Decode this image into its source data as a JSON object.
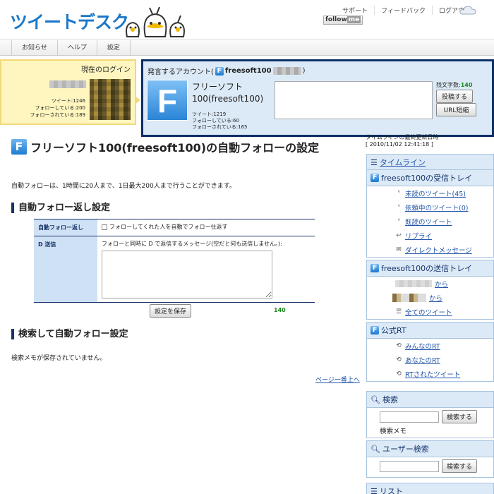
{
  "header": {
    "logo_text": "ツイートデスク",
    "nav": [
      "サポート",
      "フィードバック",
      "ログアウト"
    ],
    "followme_a": "follow",
    "followme_b": "me"
  },
  "menu": [
    "お知らせ",
    "ヘルプ",
    "設定"
  ],
  "login": {
    "title": "現在のログイン",
    "stats": [
      "ツイート:1246",
      "フォローしている:200",
      "フォローされている:189"
    ]
  },
  "post": {
    "title_prefix": "発言するアカウント(",
    "title_account": "freesoft100",
    "title_suffix": ")",
    "name": "フリーソフト100(freesoft100)",
    "stats": [
      "ツイート:1219",
      "フォローしている:60",
      "フォローされている:165"
    ],
    "remaining_label": "残文字数:",
    "remaining_value": "140",
    "submit_label": "投稿する",
    "shorten_label": "URL短縮"
  },
  "main": {
    "title": "フリーソフト100(freesoft100)の自動フォローの設定",
    "intro": "自動フォローは、1時間に20人まで、1日最大200人まで行うことができます。",
    "section1_title": "自動フォロー返し設定",
    "row1_label": "自動フォロー返し",
    "row1_text": "フォローしてくれた人を自動でフォロー仕返す",
    "row2_label": "D 送信",
    "row2_text": "フォローと同時に D で返信するメッセージ(空だと何も送信しません。):",
    "dm_count": "140",
    "save_label": "設定を保存",
    "section2_title": "検索して自動フォロー設定",
    "no_memo": "検索メモが保存されていません。",
    "to_top": "ページ一番上へ"
  },
  "sidebar": {
    "last_update_label": "タイムラインの最終更新日時",
    "last_update_value": "[ 2010/11/02 12:41:18 ]",
    "timeline": "タイムライン",
    "inbox_title": "freesoft100の受信トレイ",
    "inbox_items": [
      "未読のツイート(45)",
      "依頼中のツイート(0)",
      "既読のツイート",
      "リプライ",
      "ダイレクトメッセージ"
    ],
    "outbox_title": "freesoft100の送信トレイ",
    "outbox_from": "から",
    "outbox_all": "全てのツイート",
    "rt_title": "公式RT",
    "rt_items": [
      "みんなのRT",
      "あなたのRT",
      "RTされたツイート"
    ],
    "search_title": "検索",
    "search_button": "検索する",
    "search_memo": "検索メモ",
    "user_search_title": "ユーザー検索",
    "user_search_button": "検索する",
    "list_title": "リスト"
  }
}
